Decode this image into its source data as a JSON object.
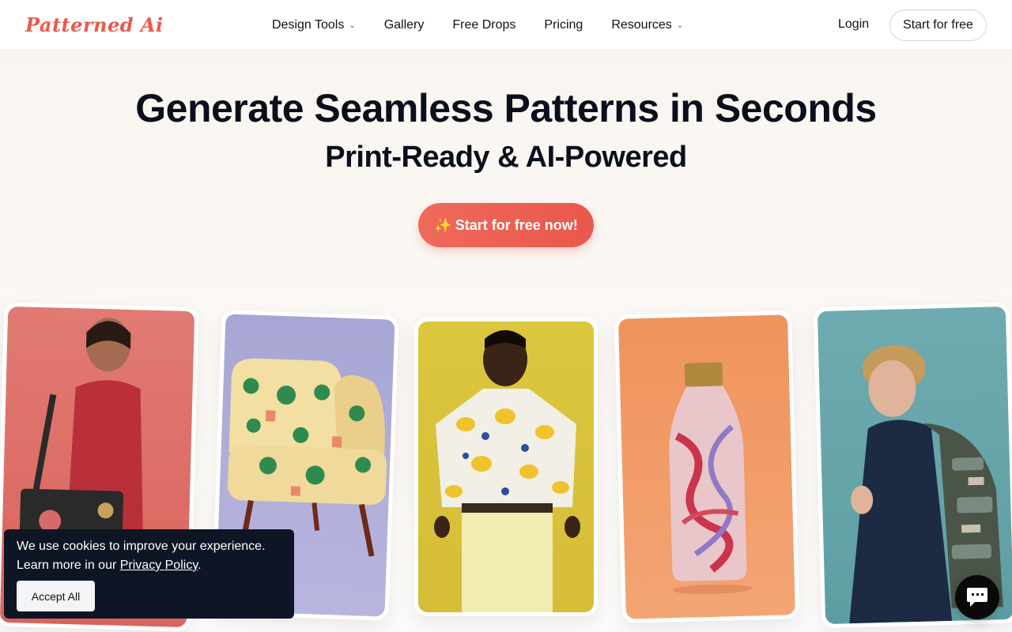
{
  "brand": {
    "logo_text": "Patterned Ai",
    "accent": "#ea5a4c"
  },
  "nav": {
    "items": [
      {
        "label": "Design Tools",
        "has_dropdown": true
      },
      {
        "label": "Gallery",
        "has_dropdown": false
      },
      {
        "label": "Free Drops",
        "has_dropdown": false
      },
      {
        "label": "Pricing",
        "has_dropdown": false
      },
      {
        "label": "Resources",
        "has_dropdown": true
      }
    ],
    "login_label": "Login",
    "start_label": "Start for free"
  },
  "hero": {
    "title": "Generate Seamless Patterns in Seconds",
    "subtitle": "Print-Ready & AI-Powered",
    "cta_label": "Start for free now!",
    "cta_icon": "sparkles-icon"
  },
  "showcase": {
    "cards": [
      {
        "subject": "woman with floral tote bag",
        "bg": "#dc6a63"
      },
      {
        "subject": "palm tree patterned armchair",
        "bg": "#aeacd8"
      },
      {
        "subject": "man in lemon print shirt",
        "bg": "#d9c23b"
      },
      {
        "subject": "marbled water bottle",
        "bg": "#f19a66"
      },
      {
        "subject": "boy with patterned backpack",
        "bg": "#66a5aa"
      }
    ]
  },
  "cookie": {
    "line1": "We use cookies to improve your experience.",
    "line2_prefix": "Learn more in our ",
    "link": "Privacy Policy",
    "line2_suffix": ".",
    "accept_label": "Accept All"
  },
  "chat": {
    "icon": "chat-icon"
  }
}
